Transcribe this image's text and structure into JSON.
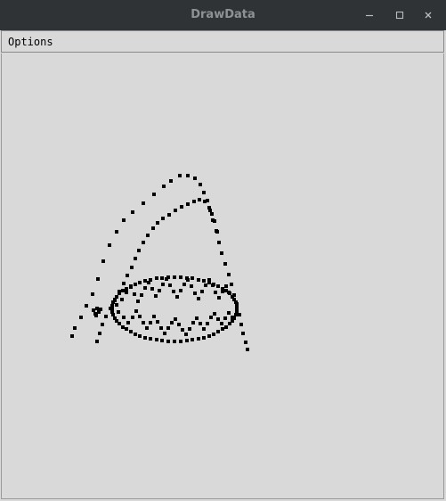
{
  "window": {
    "title": "DrawData",
    "controls": {
      "minimize_icon": "minimize-icon",
      "maximize_icon": "maximize-icon",
      "close_icon": "close-icon"
    }
  },
  "menubar": {
    "items": [
      {
        "label": "Options"
      }
    ]
  },
  "colors": {
    "titlebar": "#2f3336",
    "title_text": "#8e9296",
    "background": "#d9d9d9",
    "point": "#000000"
  }
}
